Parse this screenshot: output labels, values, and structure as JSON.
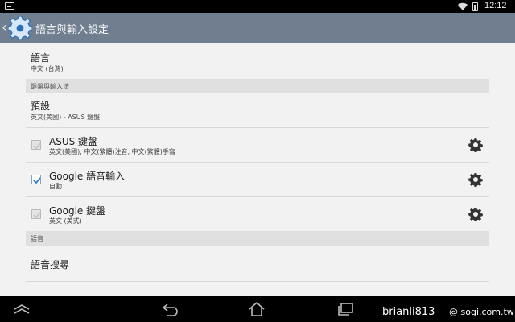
{
  "status_bar": {
    "time": "12:12",
    "icons": [
      "screenshot-icon",
      "wifi-icon",
      "battery-icon"
    ]
  },
  "action_bar": {
    "icon": "settings-gear-icon",
    "title": "語言與輸入設定"
  },
  "language": {
    "title": "語言",
    "value": "中文 (台灣)"
  },
  "keyboard_section": {
    "header": "鍵盤與輸入法",
    "default": {
      "title": "預設",
      "value": "英文(美國) - ASUS 鍵盤"
    },
    "methods": [
      {
        "title": "ASUS 鍵盤",
        "subtitle": "英文(美國), 中文(繁體)注音, 中文(繁體)手寫",
        "checked": true,
        "enabled": false
      },
      {
        "title": "Google 語音輸入",
        "subtitle": "自動",
        "checked": true,
        "enabled": true
      },
      {
        "title": "Google 鍵盤",
        "subtitle": "英文 (美式)",
        "checked": true,
        "enabled": false
      }
    ]
  },
  "speech_section": {
    "header": "語音",
    "voice_search": "語音搜尋"
  },
  "nav_bar": {
    "icons": [
      "collapse-icon",
      "back-icon",
      "home-icon",
      "recent-apps-icon"
    ]
  },
  "watermark": {
    "user": "brianli813",
    "site": "@ sogi.com.tw"
  },
  "colors": {
    "action_bar": "#707e90",
    "background": "#f2f2f2",
    "section_header": "#e0e0e0",
    "checkbox_accent": "#2f7fd1"
  }
}
